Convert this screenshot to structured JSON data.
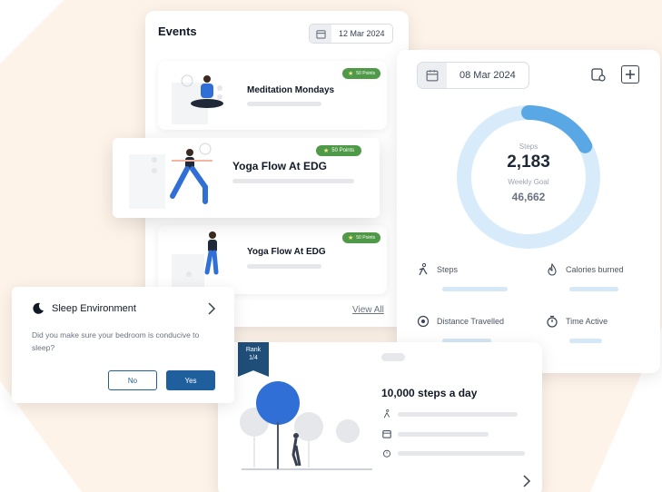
{
  "colors": {
    "background_blob": "#fdf3e9",
    "accent_blue": "#1f5f9e",
    "ring_light": "#d8ebfa",
    "ring_progress": "#5aa7e6",
    "badge_green": "#4f9a48",
    "rank_ribbon": "#1f4e79"
  },
  "events": {
    "title": "Events",
    "date": "12 Mar 2024",
    "view_all": "View All",
    "items": [
      {
        "title": "Meditation Mondays",
        "badge": "50 Points",
        "icon": "meditation-illustration"
      },
      {
        "title": "Yoga Flow At EDG",
        "badge": "50 Points",
        "icon": "yoga-illustration"
      },
      {
        "title": "Yoga Flow At EDG",
        "badge": "50 Points",
        "icon": "yoga-illustration"
      }
    ]
  },
  "steps_card": {
    "date": "08 Mar 2024",
    "ring_label": "Steps",
    "steps_value": "2,183",
    "goal_label": "Weekly Goal",
    "goal_value": "46,662",
    "progress_fraction": 0.17,
    "metrics": [
      {
        "label": "Steps",
        "icon": "walking-icon"
      },
      {
        "label": "Calories burned",
        "icon": "flame-icon"
      },
      {
        "label": "Distance Travelled",
        "icon": "location-pin-icon"
      },
      {
        "label": "Time Active",
        "icon": "stopwatch-icon"
      }
    ]
  },
  "sleep_popup": {
    "title": "Sleep Environment",
    "question": "Did you make sure your bedroom is conducive to sleep?",
    "no_label": "No",
    "yes_label": "Yes"
  },
  "challenge": {
    "rank_label": "Rank",
    "rank_value": "1/4",
    "title": "10,000 steps a day"
  }
}
